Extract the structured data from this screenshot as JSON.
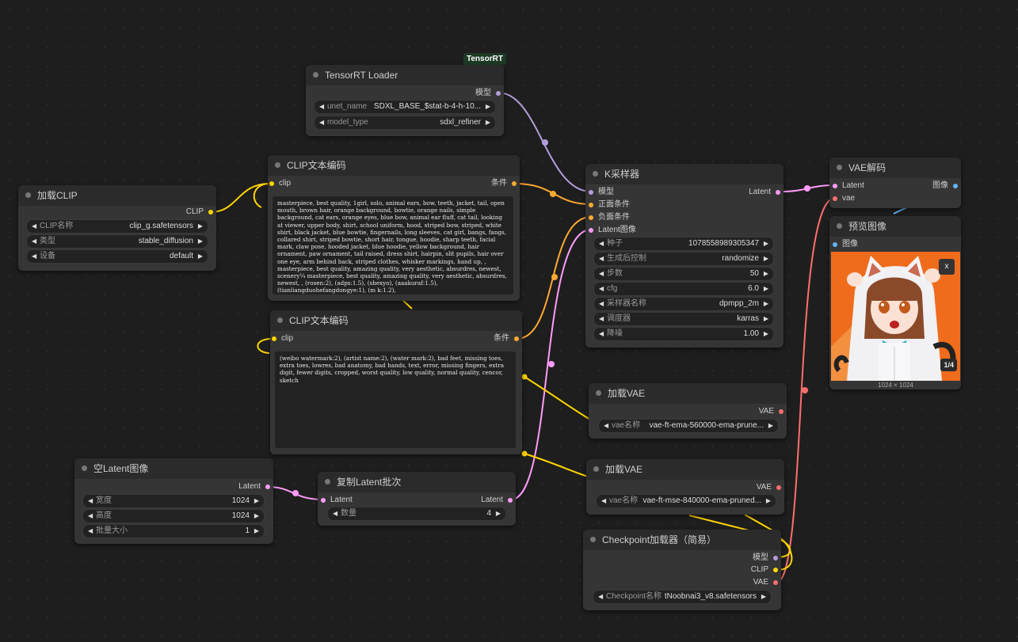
{
  "colors": {
    "model": "#b39ddb",
    "clip": "#ffd500",
    "conditioning": "#ffa931",
    "latent": "#ff9cf9",
    "vae": "#ff6e6e",
    "image": "#64b5f6"
  },
  "badge": "TensorRT",
  "tensorrt": {
    "title": "TensorRT Loader",
    "out_model": "模型",
    "unet_name": {
      "name": "unet_name",
      "value": "SDXL_BASE_$stat-b-4-h-10..."
    },
    "model_type": {
      "name": "model_type",
      "value": "sdxl_refiner"
    }
  },
  "load_clip": {
    "title": "加载CLIP",
    "out_clip": "CLIP",
    "clip_name": {
      "name": "CLIP名称",
      "value": "clip_g.safetensors"
    },
    "type": {
      "name": "类型",
      "value": "stable_diffusion"
    },
    "device": {
      "name": "设备",
      "value": "default"
    }
  },
  "clip_pos": {
    "title": "CLIP文本编码",
    "in_clip": "clip",
    "out_cond": "条件",
    "text": "masterpiece, best quality, 1girl, solo, animal ears, bow, teeth, jacket, tail, open mouth, brown hair, orange background, bowtie, orange nails, simple background, cat ears, orange eyes, blue bow, animal ear fluff, cat tail, looking at viewer, upper body, shirt, school uniform, hood, striped bow, striped, white shirt, black jacket, blue bowtie, fingernails, long sleeves, cat girl, bangs, fangs, collared shirt, striped bowtie, short hair, tongue, hoodie, sharp teeth, facial mark, claw pose, hooded jacket, blue hoodie, yellow background, hair ornament, paw ornament, tail raised, dress shirt, hairpin, slit pupils, hair over one eye, arm behind back, striped clothes, whisker markings, hand up, , masterpiece, best quality, amazing quality, very aesthetic, absurdres, newest, scenery¼ masterpiece, best quality, amazing quality, very aesthetic, absurdres, newest, , (rosen:2), (adps:1.5), (shexyo), (aaakuraf:1.5), (tianliangduohefangdongye:1), (m k:1.2),"
  },
  "clip_neg": {
    "title": "CLIP文本编码",
    "in_clip": "clip",
    "out_cond": "条件",
    "text": "(weibo watermark:2), (artist name:2), (water mark:2), bad feet, missing toes, extra toes, lowres, bad anatomy, bad hands, text, error, missing fingers, extra digit, fewer digits, cropped, worst quality, low quality, normal quality, cencor, sketch"
  },
  "ksampler": {
    "title": "K采样器",
    "in_model": "模型",
    "in_pos": "正面条件",
    "in_neg": "负面条件",
    "in_latent": "Latent图像",
    "out_latent": "Latent",
    "widgets": [
      {
        "name": "种子",
        "value": "1078558989305347"
      },
      {
        "name": "生成后控制",
        "value": "randomize"
      },
      {
        "name": "步数",
        "value": "50"
      },
      {
        "name": "cfg",
        "value": "6.0"
      },
      {
        "name": "采样器名称",
        "value": "dpmpp_2m"
      },
      {
        "name": "调度器",
        "value": "karras"
      },
      {
        "name": "降噪",
        "value": "1.00"
      }
    ]
  },
  "vae_decode": {
    "title": "VAE解码",
    "in_latent": "Latent",
    "in_vae": "vae",
    "out_image": "图像"
  },
  "preview": {
    "title": "预览图像",
    "in_image": "图像",
    "close": "x",
    "count": "1/4",
    "size": "1024 × 1024"
  },
  "load_vae_1": {
    "title": "加载VAE",
    "out_vae": "VAE",
    "vae_name": {
      "name": "vae名称",
      "value": "vae-ft-ema-560000-ema-prune..."
    }
  },
  "load_vae_2": {
    "title": "加载VAE",
    "out_vae": "VAE",
    "vae_name": {
      "name": "vae名称",
      "value": "vae-ft-mse-840000-ema-pruned..."
    }
  },
  "empty_latent": {
    "title": "空Latent图像",
    "out_latent": "Latent",
    "widgets": [
      {
        "name": "宽度",
        "value": "1024"
      },
      {
        "name": "高度",
        "value": "1024"
      },
      {
        "name": "批量大小",
        "value": "1"
      }
    ]
  },
  "repeat_latent": {
    "title": "复制Latent批次",
    "in_latent": "Latent",
    "out_latent": "Latent",
    "amount": {
      "name": "数量",
      "value": "4"
    }
  },
  "checkpoint": {
    "title": "Checkpoint加载器（简易）",
    "out_model": "模型",
    "out_clip": "CLIP",
    "out_vae": "VAE",
    "ckpt_name": {
      "name": "Checkpoint名称",
      "value": "tNoobnai3_v8.safetensors"
    }
  }
}
